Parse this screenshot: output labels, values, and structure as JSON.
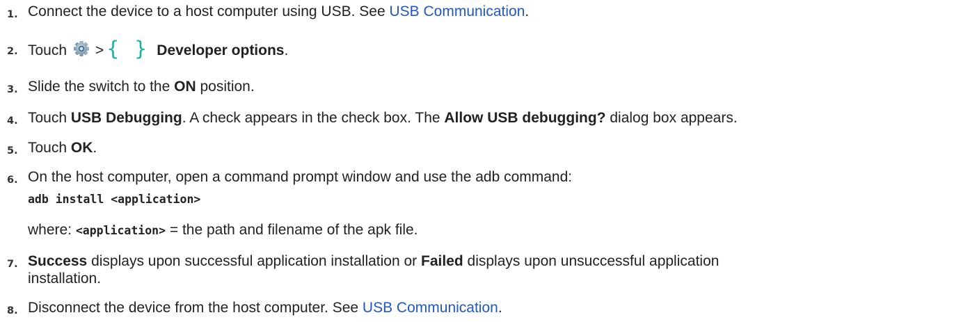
{
  "steps": [
    {
      "num": "1.",
      "text": "Connect the device to a host computer using USB. See ",
      "link": "USB Communication",
      "end": "."
    },
    {
      "num": "2.",
      "pre": "Touch",
      "gt": ">",
      "braces": "{ }",
      "bold": "Developer options",
      "end": "."
    },
    {
      "num": "3.",
      "pre": "Slide the switch to the ",
      "bold": "ON",
      "post": " position."
    },
    {
      "num": "4.",
      "pre": "Touch ",
      "bold1": "USB Debugging",
      "mid": ". A check appears in the check box. The ",
      "bold2": "Allow USB debugging?",
      "post": " dialog box appears."
    },
    {
      "num": "5.",
      "pre": "Touch ",
      "bold": "OK",
      "end": "."
    },
    {
      "num": "6.",
      "text": "On the host computer, open a command prompt window and use the adb command:",
      "code": "adb install <application>",
      "where_pre": "where: ",
      "where_code": "<application>",
      "where_post": " = the path and filename of the apk file."
    },
    {
      "num": "7.",
      "bold1": "Success",
      "mid": " displays upon successful application installation or ",
      "bold2": "Failed",
      "post": " displays upon unsuccessful application",
      "line2": "installation."
    },
    {
      "num": "8.",
      "text": "Disconnect the device from the host computer. See ",
      "link": "USB Communication",
      "end": "."
    }
  ],
  "icons": {
    "settings": "gear-icon",
    "developer": "braces-icon"
  },
  "colors": {
    "link": "#1f57c6",
    "icon_teal": "#1ab2a1"
  }
}
